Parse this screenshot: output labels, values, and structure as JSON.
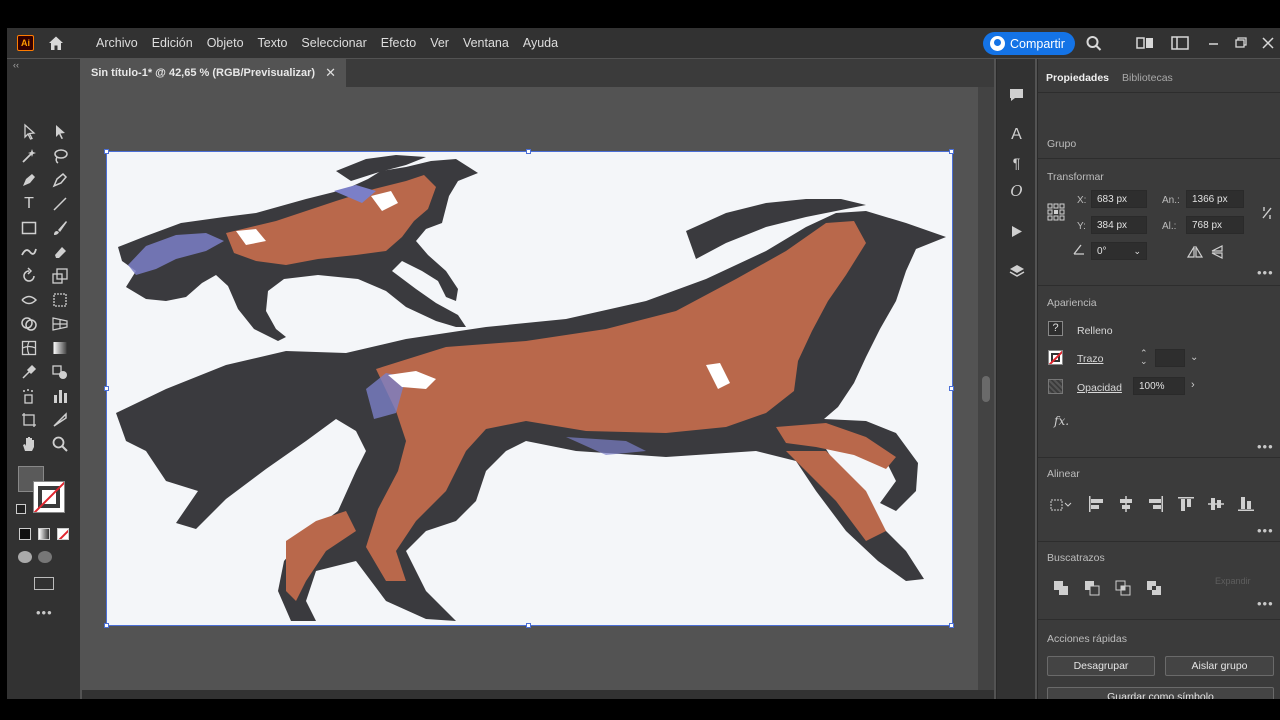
{
  "app": {
    "logo": "Ai",
    "menus": [
      "Archivo",
      "Edición",
      "Objeto",
      "Texto",
      "Seleccionar",
      "Efecto",
      "Ver",
      "Ventana",
      "Ayuda"
    ],
    "share_label": "Compartir"
  },
  "document": {
    "tab_title": "Sin título-1* @ 42,65 % (RGB/Previsualizar)"
  },
  "panel": {
    "tabs": [
      "Propiedades",
      "Bibliotecas"
    ],
    "selection_type": "Grupo",
    "transform": {
      "title": "Transformar",
      "x_label": "X:",
      "x_value": "683 px",
      "y_label": "Y:",
      "y_value": "384 px",
      "w_label": "An.:",
      "w_value": "1366 px",
      "h_label": "Al.:",
      "h_value": "768 px",
      "rotate_value": "0°"
    },
    "appearance": {
      "title": "Apariencia",
      "fill_label": "Relleno",
      "stroke_label": "Trazo",
      "opacity_label": "Opacidad",
      "opacity_value": "100%",
      "fx_label": "fx."
    },
    "align_title": "Alinear",
    "pathfinder_title": "Buscatrazos",
    "pathfinder_expand": "Expandir",
    "quick_actions": {
      "title": "Acciones rápidas",
      "ungroup": "Desagrupar",
      "isolate": "Aislar grupo",
      "save_symbol": "Guardar como símbolo"
    }
  },
  "colors": {
    "share_blue": "#1473e6",
    "horse_brown": "#b9684b",
    "horse_dark": "#3a3a3e",
    "horse_highlight": "#7b7fc7",
    "selection_blue": "#4b6fd6"
  }
}
